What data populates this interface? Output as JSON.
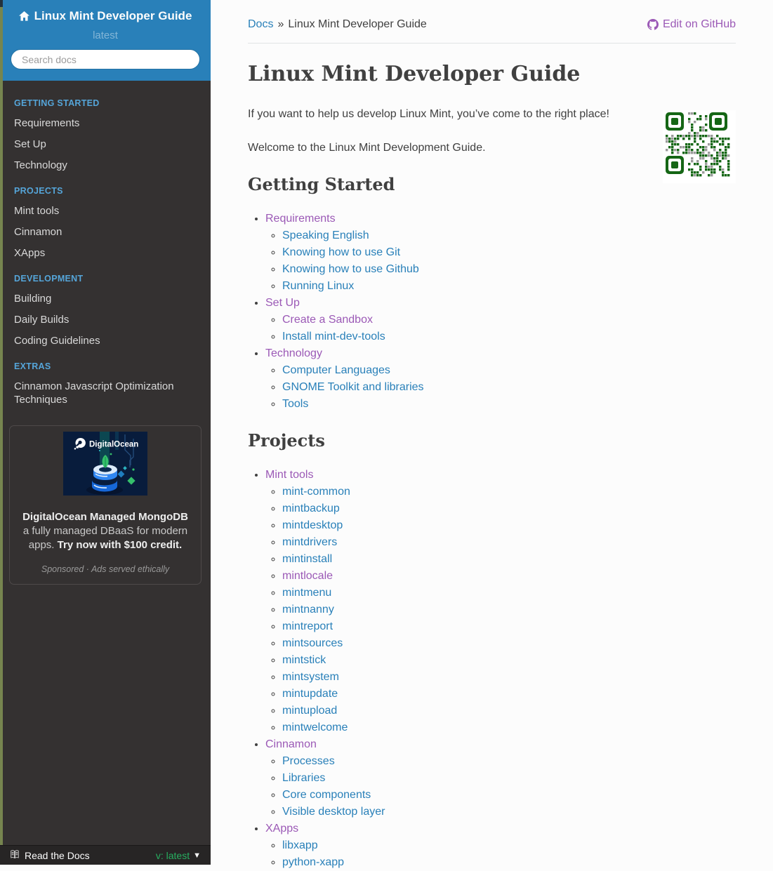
{
  "colors": {
    "header_blue": "#2980b9",
    "sidebar_bg": "#343131",
    "caption_blue": "#55a5d9",
    "link_blue": "#2980b9",
    "visited_purple": "#9b59b6",
    "version_green": "#27ae60",
    "footer_bg": "#272525",
    "content_bg": "#fcfcfc",
    "qr_green": "#156615"
  },
  "sidebar": {
    "title": "Linux Mint Developer Guide",
    "version": "latest",
    "search_placeholder": "Search docs",
    "sections": [
      {
        "caption": "GETTING STARTED",
        "items": [
          "Requirements",
          "Set Up",
          "Technology"
        ]
      },
      {
        "caption": "PROJECTS",
        "items": [
          "Mint tools",
          "Cinnamon",
          "XApps"
        ]
      },
      {
        "caption": "DEVELOPMENT",
        "items": [
          "Building",
          "Daily Builds",
          "Coding Guidelines"
        ]
      },
      {
        "caption": "EXTRAS",
        "items": [
          "Cinnamon Javascript Optimization Techniques"
        ]
      }
    ],
    "ad": {
      "brand": "DigitalOcean",
      "headline_bold": "DigitalOcean Managed MongoDB",
      "headline_rest": " a fully managed DBaaS for modern apps. ",
      "headline_cta": "Try now with $100 credit.",
      "sponsored": "Sponsored · Ads served ethically"
    },
    "footer": {
      "brand": "Read the Docs",
      "version_label": "v: latest"
    }
  },
  "breadcrumb": {
    "root": "Docs",
    "separator": "»",
    "current": "Linux Mint Developer Guide"
  },
  "edit_link_label": "Edit on GitHub",
  "content": {
    "title": "Linux Mint Developer Guide",
    "paragraphs": [
      "If you want to help us develop Linux Mint, you’ve come to the right place!",
      "Welcome to the Linux Mint Development Guide."
    ],
    "sections": [
      {
        "heading": "Getting Started",
        "items": [
          {
            "label": "Requirements",
            "visited": true,
            "children": [
              {
                "label": "Speaking English",
                "visited": false
              },
              {
                "label": "Knowing how to use Git",
                "visited": false
              },
              {
                "label": "Knowing how to use Github",
                "visited": false
              },
              {
                "label": "Running Linux",
                "visited": false
              }
            ]
          },
          {
            "label": "Set Up",
            "visited": true,
            "children": [
              {
                "label": "Create a Sandbox",
                "visited": true
              },
              {
                "label": "Install mint-dev-tools",
                "visited": false
              }
            ]
          },
          {
            "label": "Technology",
            "visited": true,
            "children": [
              {
                "label": "Computer Languages",
                "visited": false
              },
              {
                "label": "GNOME Toolkit and libraries",
                "visited": false
              },
              {
                "label": "Tools",
                "visited": false
              }
            ]
          }
        ]
      },
      {
        "heading": "Projects",
        "items": [
          {
            "label": "Mint tools",
            "visited": true,
            "children": [
              {
                "label": "mint-common",
                "visited": false
              },
              {
                "label": "mintbackup",
                "visited": false
              },
              {
                "label": "mintdesktop",
                "visited": false
              },
              {
                "label": "mintdrivers",
                "visited": false
              },
              {
                "label": "mintinstall",
                "visited": false
              },
              {
                "label": "mintlocale",
                "visited": true
              },
              {
                "label": "mintmenu",
                "visited": false
              },
              {
                "label": "mintnanny",
                "visited": false
              },
              {
                "label": "mintreport",
                "visited": false
              },
              {
                "label": "mintsources",
                "visited": false
              },
              {
                "label": "mintstick",
                "visited": false
              },
              {
                "label": "mintsystem",
                "visited": false
              },
              {
                "label": "mintupdate",
                "visited": false
              },
              {
                "label": "mintupload",
                "visited": false
              },
              {
                "label": "mintwelcome",
                "visited": false
              }
            ]
          },
          {
            "label": "Cinnamon",
            "visited": true,
            "children": [
              {
                "label": "Processes",
                "visited": false
              },
              {
                "label": "Libraries",
                "visited": false
              },
              {
                "label": "Core components",
                "visited": false
              },
              {
                "label": "Visible desktop layer",
                "visited": false
              }
            ]
          },
          {
            "label": "XApps",
            "visited": true,
            "children": [
              {
                "label": "libxapp",
                "visited": false
              },
              {
                "label": "python-xapp",
                "visited": false
              }
            ]
          }
        ]
      }
    ]
  }
}
